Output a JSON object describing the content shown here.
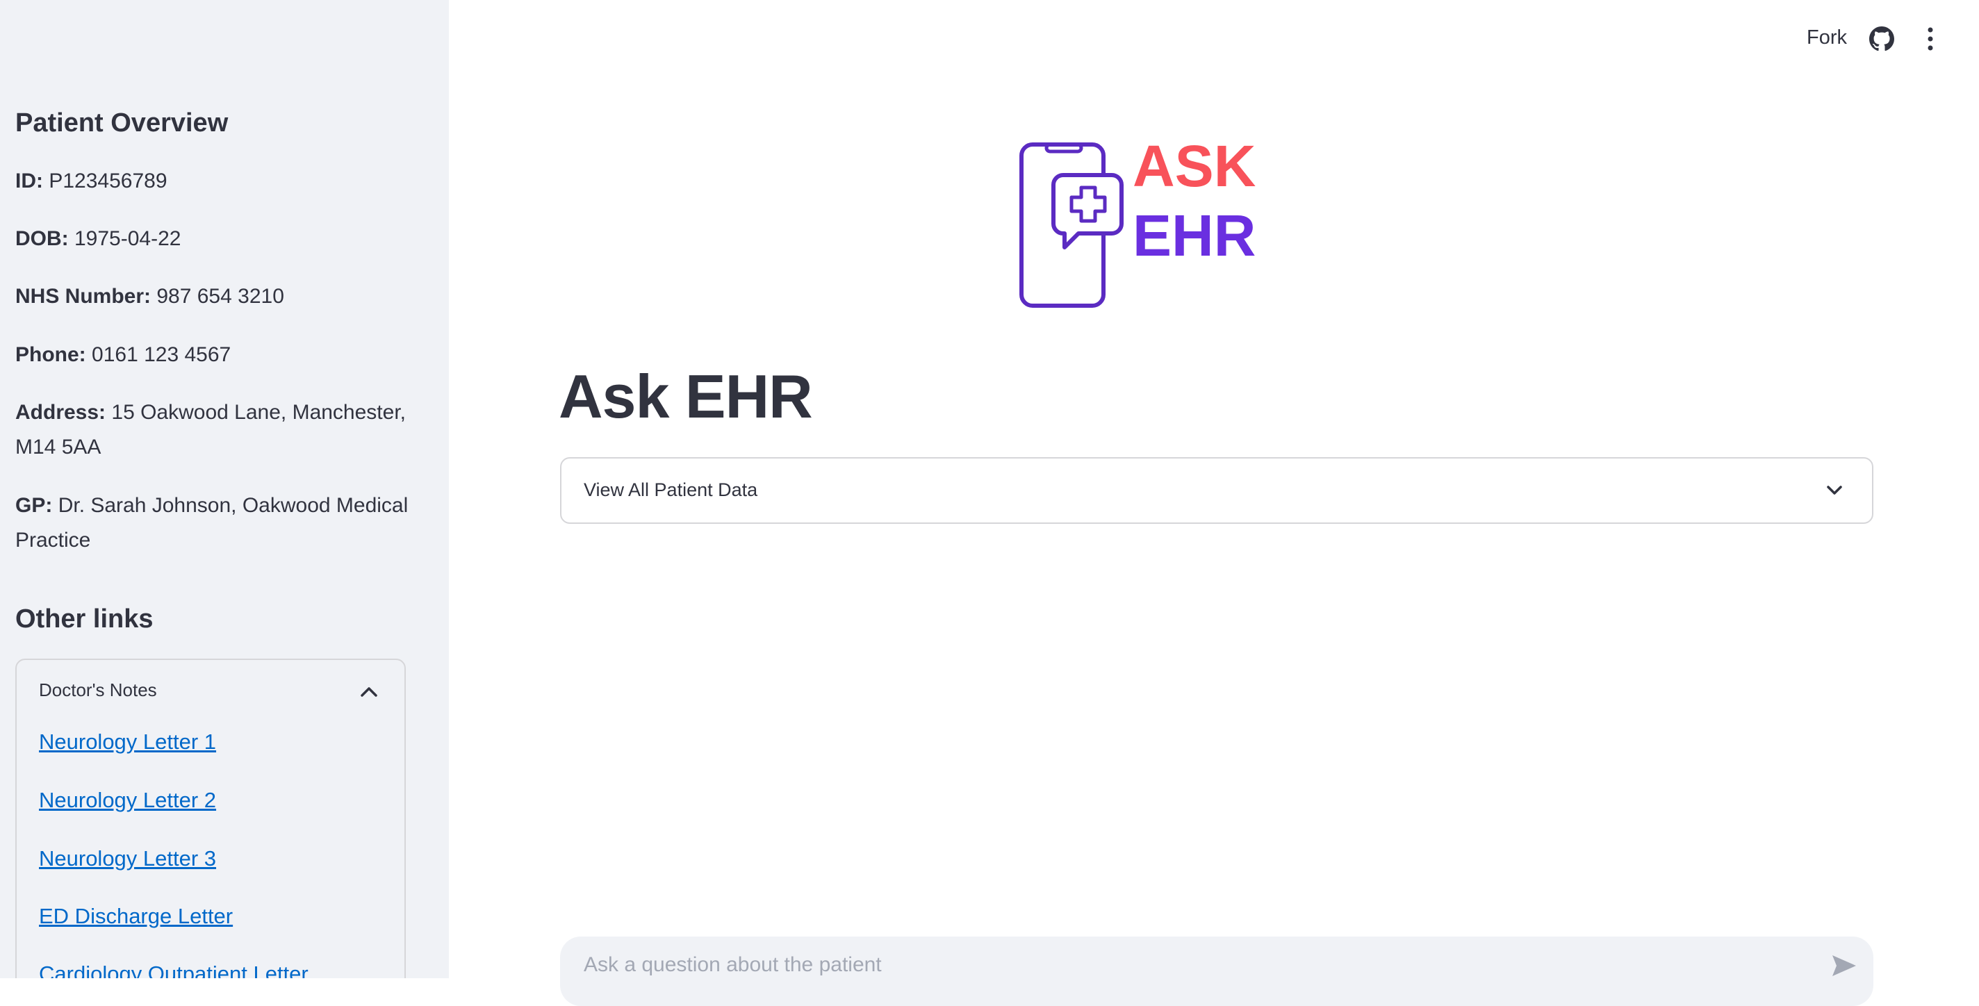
{
  "sidebar": {
    "overview_title": "Patient Overview",
    "fields": [
      {
        "label": "ID:",
        "value": "P123456789"
      },
      {
        "label": "DOB:",
        "value": "1975-04-22"
      },
      {
        "label": "NHS Number:",
        "value": "987 654 3210"
      },
      {
        "label": "Phone:",
        "value": "0161 123 4567"
      },
      {
        "label": "Address:",
        "value": "15 Oakwood Lane, Manchester, M14 5AA"
      },
      {
        "label": "GP:",
        "value": "Dr. Sarah Johnson, Oakwood Medical Practice"
      }
    ],
    "other_links_title": "Other links",
    "doctors_notes": {
      "label": "Doctor's Notes",
      "links": [
        "Neurology Letter 1",
        "Neurology Letter 2",
        "Neurology Letter 3",
        "ED Discharge Letter",
        "Cardiology Outpatient Letter"
      ]
    }
  },
  "toolbar": {
    "fork_label": "Fork",
    "github_icon": "github-icon",
    "menu_icon": "kebab-menu-icon"
  },
  "logo": {
    "line1": "ASK",
    "line2": "EHR",
    "colors": {
      "ask": "#f8525a",
      "ehr": "#6a2fe0",
      "outline": "#5b2bc2"
    }
  },
  "main": {
    "title": "Ask EHR",
    "data_expander_label": "View All Patient Data"
  },
  "chat": {
    "placeholder": "Ask a question about the patient"
  },
  "colors": {
    "sidebar_bg": "#f0f2f6",
    "link": "#0068c9",
    "text": "#31333f"
  }
}
